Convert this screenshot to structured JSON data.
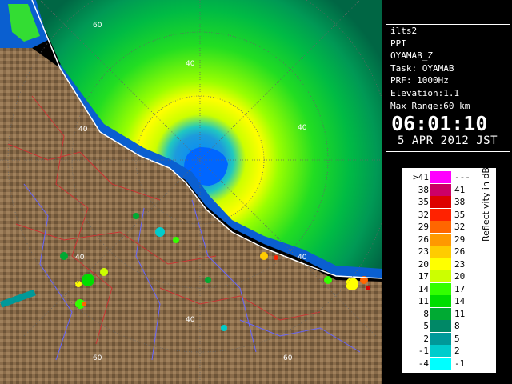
{
  "info": {
    "lines": [
      "ilts2",
      "PPI",
      "OYAMAB_Z",
      "Task: OYAMAB",
      "PRF: 1000Hz",
      "Elevation:1.1",
      "Max Range:60 km"
    ],
    "time": "06:01:10",
    "date": "5 APR 2012 JST"
  },
  "legend": {
    "title": "Reflectivity in dBZ",
    "rows": [
      {
        "lo": ">41",
        "hi": "---",
        "color": "#ff00ff"
      },
      {
        "lo": "38",
        "hi": "41",
        "color": "#cc0066"
      },
      {
        "lo": "35",
        "hi": "38",
        "color": "#dd0000"
      },
      {
        "lo": "32",
        "hi": "35",
        "color": "#ff2200"
      },
      {
        "lo": "29",
        "hi": "32",
        "color": "#ff6600"
      },
      {
        "lo": "26",
        "hi": "29",
        "color": "#ff9900"
      },
      {
        "lo": "23",
        "hi": "26",
        "color": "#ffcc00"
      },
      {
        "lo": "20",
        "hi": "23",
        "color": "#ffff00"
      },
      {
        "lo": "17",
        "hi": "20",
        "color": "#ccff00"
      },
      {
        "lo": "14",
        "hi": "17",
        "color": "#33ff00"
      },
      {
        "lo": "11",
        "hi": "14",
        "color": "#00dd00"
      },
      {
        "lo": "8",
        "hi": "11",
        "color": "#00aa33"
      },
      {
        "lo": "5",
        "hi": "8",
        "color": "#008866"
      },
      {
        "lo": "2",
        "hi": "5",
        "color": "#009999"
      },
      {
        "lo": "-1",
        "hi": "2",
        "color": "#00cccc"
      },
      {
        "lo": "-4",
        "hi": "-1",
        "color": "#00ffff"
      }
    ]
  },
  "map": {
    "ring_labels": [
      "40",
      "60",
      "40",
      "40",
      "40",
      "40",
      "60",
      "60",
      "40"
    ]
  }
}
